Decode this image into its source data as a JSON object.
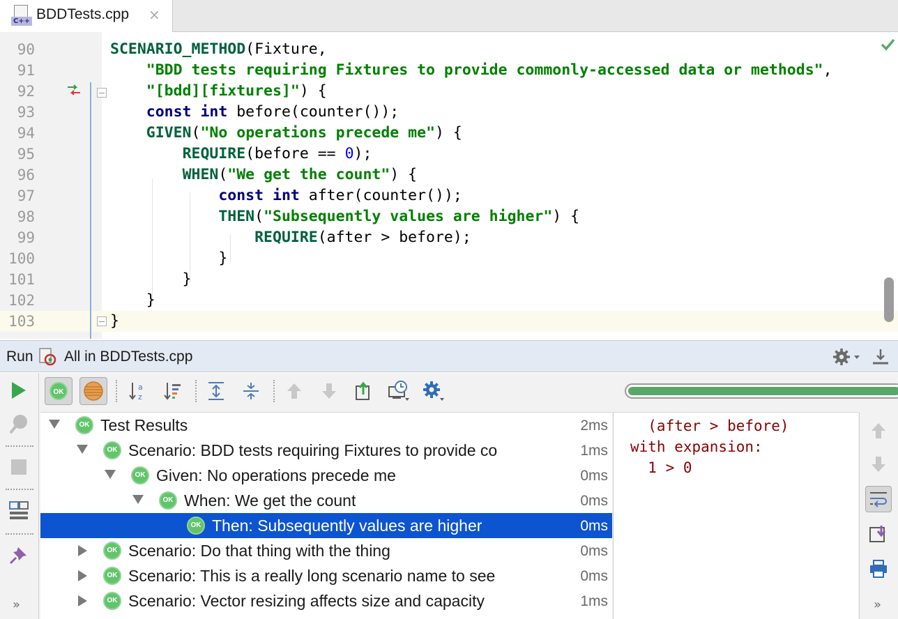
{
  "editor": {
    "tab": {
      "file_name": "BDDTests.cpp",
      "lang_badge": "C++",
      "close_glyph": "×"
    },
    "line_numbers": [
      "90",
      "91",
      "92",
      "93",
      "94",
      "95",
      "96",
      "97",
      "98",
      "99",
      "100",
      "101",
      "102",
      "103"
    ],
    "code_lines": [
      [
        {
          "t": "mac",
          "v": "SCENARIO_METHOD"
        },
        {
          "t": "p",
          "v": "(Fixture,"
        }
      ],
      [
        {
          "t": "p",
          "v": "    "
        },
        {
          "t": "str",
          "v": "\"BDD tests requiring Fixtures to provide commonly-accessed data or methods\""
        },
        {
          "t": "p",
          "v": ","
        }
      ],
      [
        {
          "t": "p",
          "v": "    "
        },
        {
          "t": "str",
          "v": "\"[bdd][fixtures]\""
        },
        {
          "t": "p",
          "v": ") {"
        }
      ],
      [
        {
          "t": "p",
          "v": "    "
        },
        {
          "t": "kw",
          "v": "const int"
        },
        {
          "t": "p",
          "v": " before(counter());"
        }
      ],
      [
        {
          "t": "p",
          "v": "    "
        },
        {
          "t": "mac",
          "v": "GIVEN"
        },
        {
          "t": "p",
          "v": "("
        },
        {
          "t": "str",
          "v": "\"No operations precede me\""
        },
        {
          "t": "p",
          "v": ") {"
        }
      ],
      [
        {
          "t": "p",
          "v": "        "
        },
        {
          "t": "mac",
          "v": "REQUIRE"
        },
        {
          "t": "p",
          "v": "(before == "
        },
        {
          "t": "num",
          "v": "0"
        },
        {
          "t": "p",
          "v": ");"
        }
      ],
      [
        {
          "t": "p",
          "v": "        "
        },
        {
          "t": "mac",
          "v": "WHEN"
        },
        {
          "t": "p",
          "v": "("
        },
        {
          "t": "str",
          "v": "\"We get the count\""
        },
        {
          "t": "p",
          "v": ") {"
        }
      ],
      [
        {
          "t": "p",
          "v": "            "
        },
        {
          "t": "kw",
          "v": "const int"
        },
        {
          "t": "p",
          "v": " after(counter());"
        }
      ],
      [
        {
          "t": "p",
          "v": "            "
        },
        {
          "t": "mac",
          "v": "THEN"
        },
        {
          "t": "p",
          "v": "("
        },
        {
          "t": "str",
          "v": "\"Subsequently values are higher\""
        },
        {
          "t": "p",
          "v": ") {"
        }
      ],
      [
        {
          "t": "p",
          "v": "                "
        },
        {
          "t": "mac",
          "v": "REQUIRE"
        },
        {
          "t": "p",
          "v": "(after > before);"
        }
      ],
      [
        {
          "t": "p",
          "v": "            }"
        }
      ],
      [
        {
          "t": "p",
          "v": "        }"
        }
      ],
      [
        {
          "t": "p",
          "v": "    }"
        }
      ],
      [
        {
          "t": "p",
          "v": "}"
        }
      ]
    ]
  },
  "run": {
    "label": "Run",
    "config_name": "All in BDDTests.cpp",
    "progress": 1.0,
    "left_toolbar_more": "»",
    "right_toolbar_more": "»",
    "ok_badge": "OK"
  },
  "tree": [
    {
      "label": "Test Results",
      "time": "2ms",
      "level": 0,
      "expanded": true,
      "selected": false
    },
    {
      "label": "Scenario: BDD tests requiring Fixtures to provide co",
      "time": "1ms",
      "level": 1,
      "expanded": true,
      "selected": false
    },
    {
      "label": "Given: No operations precede me",
      "time": "0ms",
      "level": 2,
      "expanded": true,
      "selected": false
    },
    {
      "label": "When: We get the count",
      "time": "0ms",
      "level": 3,
      "expanded": true,
      "selected": false
    },
    {
      "label": "Then: Subsequently values are higher",
      "time": "0ms",
      "level": 4,
      "expanded": null,
      "selected": true
    },
    {
      "label": "Scenario: Do that thing with the thing",
      "time": "0ms",
      "level": 1,
      "expanded": false,
      "selected": false
    },
    {
      "label": "Scenario: This is a really long scenario name to see",
      "time": "0ms",
      "level": 1,
      "expanded": false,
      "selected": false
    },
    {
      "label": "Scenario: Vector resizing affects size and capacity",
      "time": "1ms",
      "level": 1,
      "expanded": false,
      "selected": false
    }
  ],
  "console": {
    "text": "  (after > before)\nwith expansion:\n  1 > 0"
  },
  "colors": {
    "accent_selection": "#0d54d0",
    "ok_green": "#62c46b",
    "run_green": "#3aa64b",
    "console_text": "#8b0000"
  },
  "icons": {
    "top_toolbar": [
      "show-passed-icon",
      "show-ignored-icon",
      "sort-alpha-icon",
      "sort-duration-icon",
      "expand-all-icon",
      "collapse-all-icon",
      "previous-failed-icon",
      "next-failed-icon",
      "export-icon",
      "history-icon",
      "settings-icon"
    ],
    "left_toolbar": [
      "rerun-icon",
      "rerun-failed-icon",
      "stop-icon",
      "layout-icon",
      "pin-icon"
    ],
    "right_toolbar": [
      "scroll-up-icon",
      "scroll-down-icon",
      "soft-wrap-icon",
      "scroll-to-end-icon",
      "print-icon"
    ]
  }
}
